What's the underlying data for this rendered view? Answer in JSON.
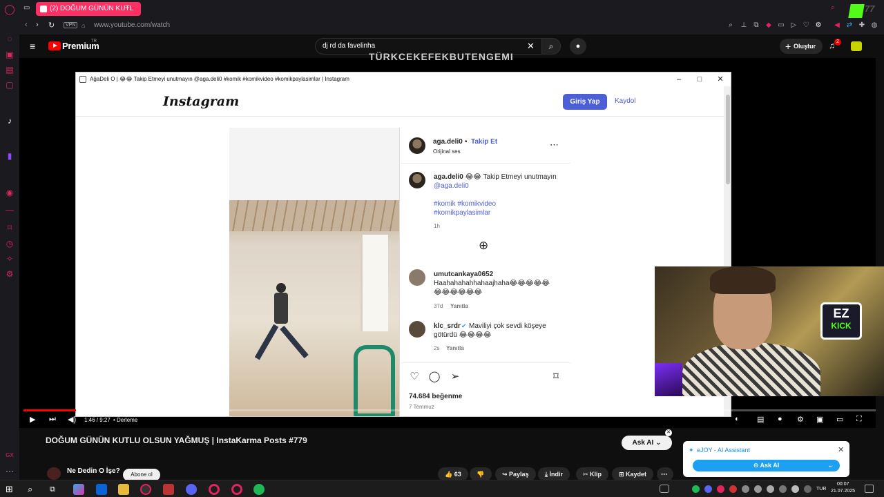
{
  "browser": {
    "tab_title": "(2) DOĞUM GÜNÜN KUTL",
    "new_tab": "+",
    "vpn_label": "VPN",
    "url": "www.youtube.com/watch"
  },
  "youtube": {
    "brand": "Premium",
    "region": "TR",
    "search_value": "dj rd da favelinha",
    "create_label": "Oluştur",
    "notification_count": "2",
    "background_title": "TÜRKCEKEFEKBUTENGEMI",
    "video_title": "DOĞUM GÜNÜN KUTLU OLSUN YAĞMUŞ | InstaKarma Posts #779",
    "time": "1:46 / 9:27",
    "chapter": "• Derleme",
    "ask_label": "Ask AI",
    "channel_name": "Ne Dedin O İşe?",
    "subscribe_label": "Abone ol",
    "actions": {
      "likes": "63",
      "share": "Paylaş",
      "download": "İndir",
      "clip": "Klip",
      "save": "Kaydet"
    }
  },
  "instagram_window": {
    "title": "AğaDeli O | 😂😂 Takip Etmeyi unutmayın @aga.deli0 #komik #komikvideo #komikpaylasimlar | Instagram",
    "logo": "Instagram",
    "login": "Giriş Yap",
    "signup": "Kaydol",
    "post": {
      "username": "aga.deli0",
      "follow": "Takip Et",
      "audio": "Orijinal ses",
      "caption_user": "aga.deli0",
      "caption_text": "😂😂 Takip Etmeyi unutmayın",
      "caption_mention": "@aga.deli0",
      "hashtags_line1": "#komik #komikvideo",
      "hashtags_line2": "#komikpaylasimlar",
      "caption_age": "1h",
      "likes": "74.684 beğenme",
      "date": "7 Temmuz"
    },
    "comments": [
      {
        "user": "umutcankaya0652",
        "text": "Haahahahahhahaajhaha😂😂😂😂😂",
        "text2": "😂😂😂😂😂😂",
        "age": "37d",
        "reply": "Yanıtla"
      },
      {
        "user": "klc_srdr",
        "text": "Maviliyi çok sevdi köşeye",
        "text2": "götürdü 😂😂😂😂",
        "age": "2s",
        "reply": "Yanıtla"
      }
    ]
  },
  "ejoy": {
    "title": "eJOY - AI Assistant",
    "button": "Ask AI"
  },
  "taskbar": {
    "time": "00:07",
    "date": "21.07.2025",
    "lang": "TUR"
  }
}
